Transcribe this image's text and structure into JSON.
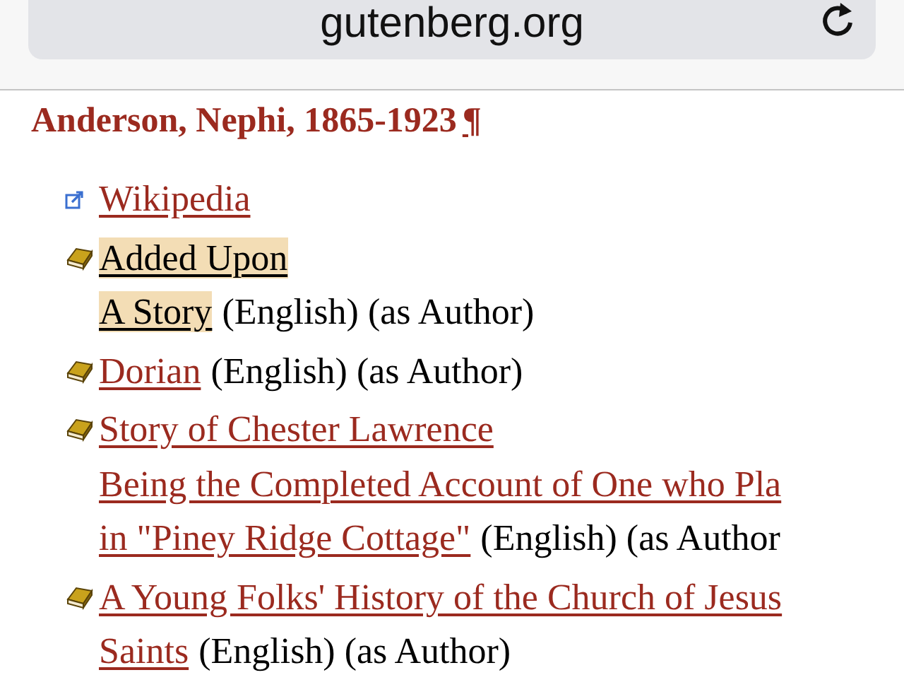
{
  "browser": {
    "address": "gutenberg.org"
  },
  "heading": {
    "text": "Anderson, Nephi, 1865-1923",
    "mark": "¶"
  },
  "items": [
    {
      "kind": "external",
      "title_lines": [
        "Wikipedia"
      ],
      "highlighted": false
    },
    {
      "kind": "book",
      "title_lines": [
        "Added Upon ",
        "A Story"
      ],
      "suffix": "(English) (as Author)",
      "highlighted": true
    },
    {
      "kind": "book",
      "title_lines": [
        "Dorian"
      ],
      "suffix": "(English) (as Author)",
      "highlighted": false
    },
    {
      "kind": "book",
      "title_lines": [
        "Story of Chester Lawrence ",
        "Being the Completed Account of One who Pla",
        "in \"Piney Ridge Cottage\""
      ],
      "suffix": "(English) (as Author",
      "highlighted": false
    },
    {
      "kind": "book",
      "title_lines": [
        "A Young Folks' History of the Church of Jesus",
        "Saints"
      ],
      "suffix": "(English) (as Author)",
      "highlighted": false
    }
  ]
}
